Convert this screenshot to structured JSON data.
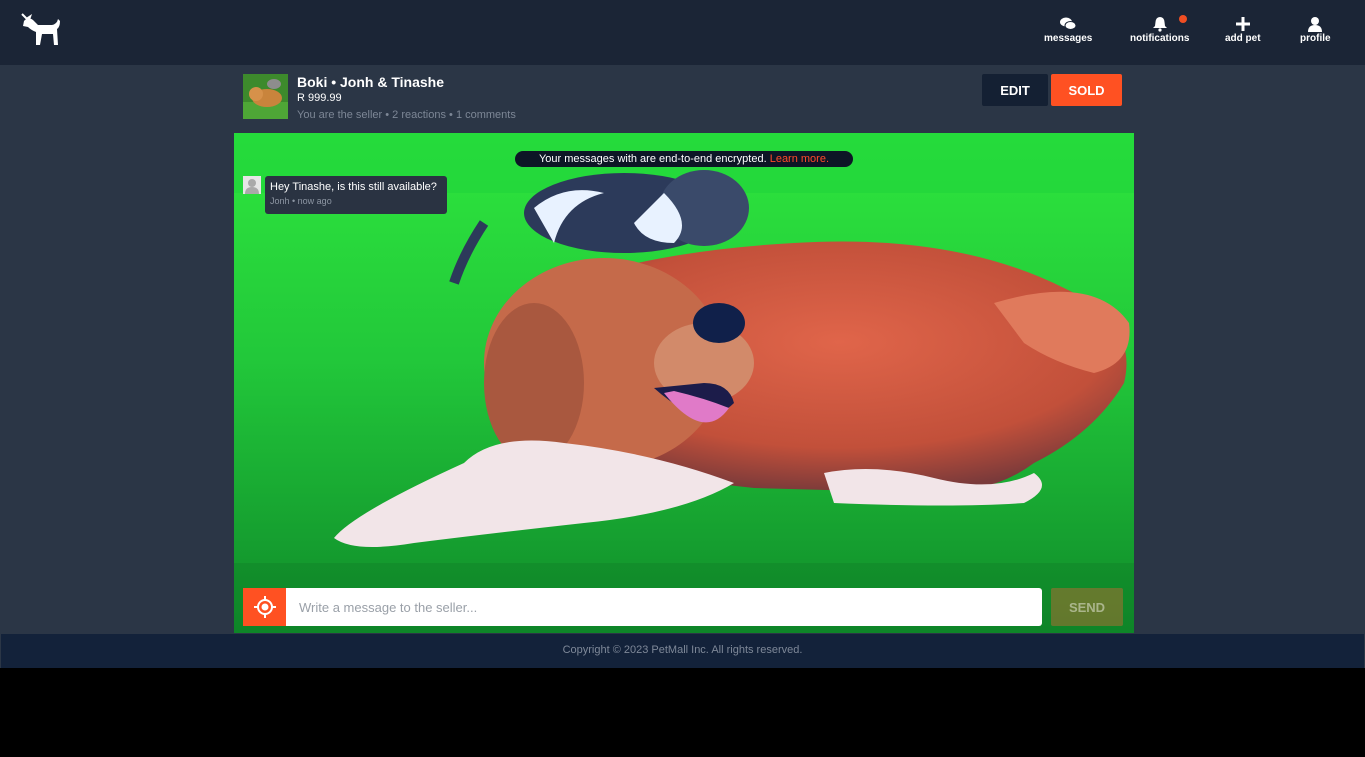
{
  "header": {
    "logo_icon": "dog-icon",
    "nav": [
      {
        "label": "messages",
        "icon": "chat-bubbles-icon"
      },
      {
        "label": "notifications",
        "icon": "bell-icon",
        "has_badge": true
      },
      {
        "label": "add pet",
        "icon": "plus-icon"
      },
      {
        "label": "profile",
        "icon": "user-icon"
      }
    ]
  },
  "listing": {
    "title": "Boki • Jonh & Tinashe",
    "price": "R 999.99",
    "meta": "You are the seller • 2 reactions • 1 comments",
    "edit_label": "EDIT",
    "sold_label": "SOLD"
  },
  "chat": {
    "encryption_notice": "Your messages with are end-to-end encrypted.",
    "learn_more": "Learn more.",
    "messages": [
      {
        "text": "Hey Tinashe, is this still available?",
        "meta": "Jonh • now ago"
      }
    ],
    "input_placeholder": "Write a message to the seller...",
    "send_label": "SEND"
  },
  "footer": {
    "copyright": "Copyright © 2023 PetMall Inc. All rights reserved."
  },
  "colors": {
    "accent": "#ff5122",
    "header_bg": "#1b2536",
    "page_bg": "#2b3646",
    "footer_bg": "#13223a",
    "dark_button": "#142033"
  }
}
